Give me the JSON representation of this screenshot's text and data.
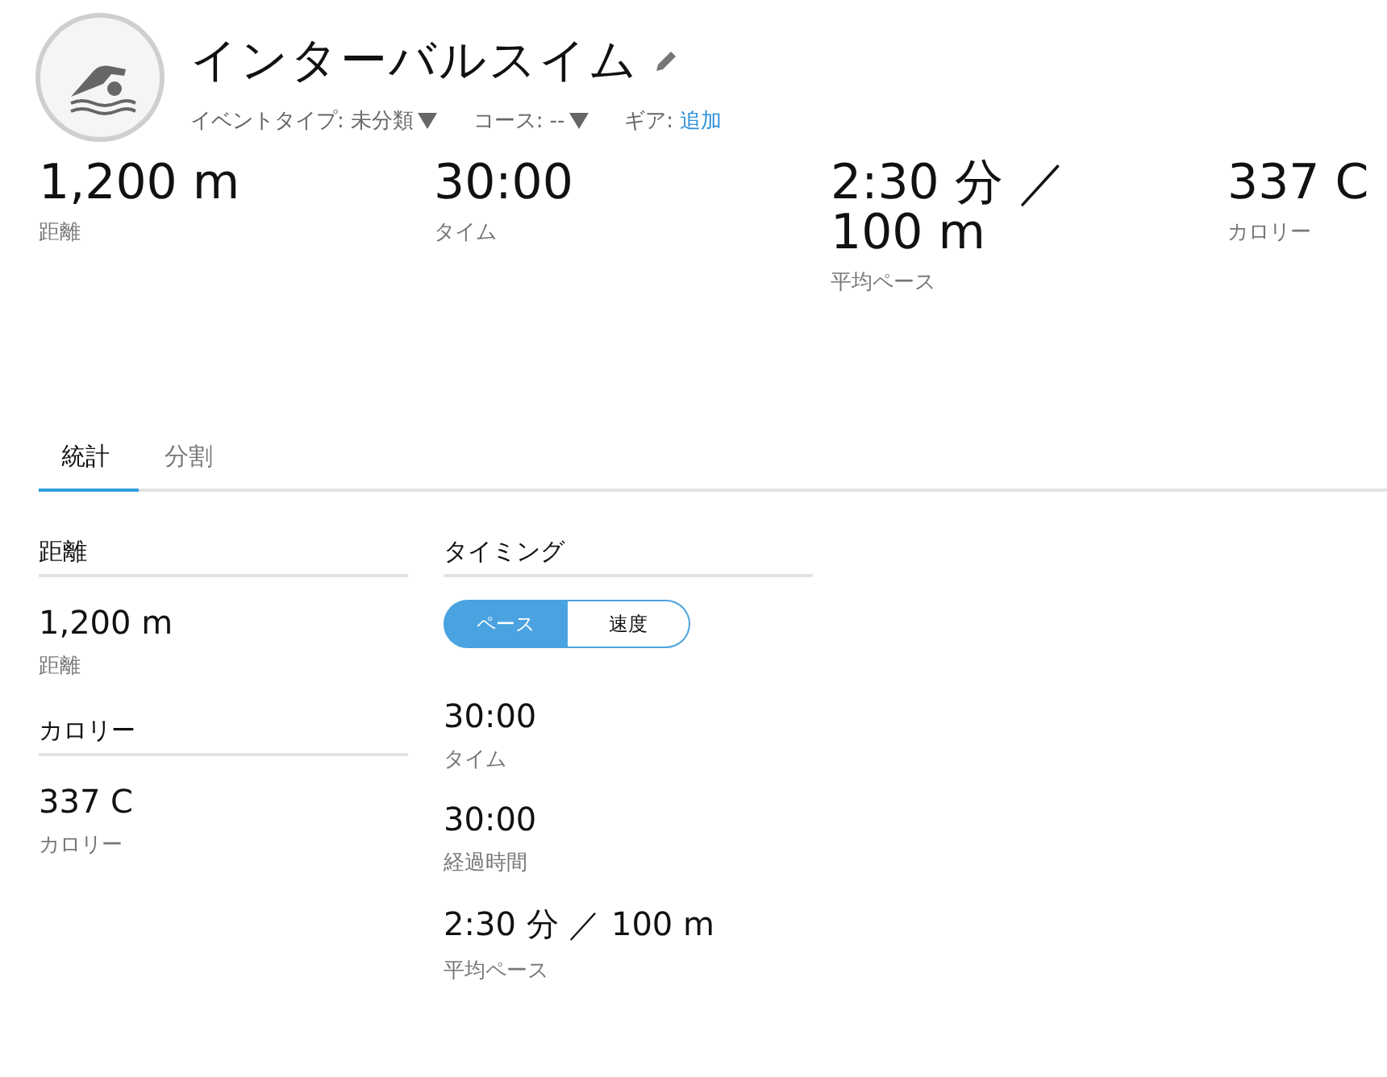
{
  "title": "インターバルスイム",
  "meta": [
    {
      "label": "イベントタイプ:",
      "value": "未分類",
      "kind": "dropdown"
    },
    {
      "label": "コース:",
      "value": "--",
      "kind": "dropdown"
    },
    {
      "label": "ギア:",
      "value": "追加",
      "kind": "link"
    }
  ],
  "summary": [
    {
      "value": "1,200 m",
      "label": "距離"
    },
    {
      "value": "30:00",
      "label": "タイム"
    },
    {
      "value": "2:30 分 ／ 100 m",
      "label": "平均ペース"
    },
    {
      "value": "337 C",
      "label": "カロリー"
    }
  ],
  "tabs": [
    {
      "label": "統計",
      "selected": true
    },
    {
      "label": "分割",
      "selected": false
    }
  ],
  "left_sections": [
    {
      "heading": "距離",
      "stats": [
        {
          "value": "1,200 m",
          "label": "距離"
        }
      ]
    },
    {
      "heading": "カロリー",
      "stats": [
        {
          "value": "337 C",
          "label": "カロリー"
        }
      ]
    }
  ],
  "timing": {
    "heading": "タイミング",
    "toggle": [
      {
        "label": "ペース",
        "selected": true
      },
      {
        "label": "速度",
        "selected": false
      }
    ],
    "stats": [
      {
        "value": "30:00",
        "label": "タイム"
      },
      {
        "value": "30:00",
        "label": "経過時間"
      },
      {
        "value": "2:30 分 ／ 100 m",
        "label": "平均ペース"
      }
    ]
  }
}
